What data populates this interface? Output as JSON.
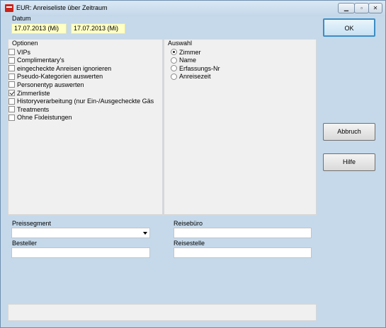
{
  "window": {
    "title": "EUR: Anreiseliste über Zeitraum",
    "controls": {
      "minimize": "▁",
      "maximize": "▫",
      "close": "✕"
    }
  },
  "datum": {
    "label": "Datum",
    "from": "17.07.2013 (Mi)",
    "to": "17.07.2013 (Mi)"
  },
  "optionen": {
    "label": "Optionen",
    "items": [
      {
        "label": "VIPs",
        "checked": false
      },
      {
        "label": "Complimentary's",
        "checked": false
      },
      {
        "label": "eingecheckte Anreisen ignorieren",
        "checked": false
      },
      {
        "label": "Pseudo-Kategorien auswerten",
        "checked": false
      },
      {
        "label": "Personentyp auswerten",
        "checked": false
      },
      {
        "label": "Zimmerliste",
        "checked": true
      },
      {
        "label": "Historyverarbeitung (nur Ein-/Ausgecheckte Gäs",
        "checked": false
      },
      {
        "label": "Treatments",
        "checked": false
      },
      {
        "label": "Ohne Fixleistungen",
        "checked": false
      }
    ]
  },
  "auswahl": {
    "label": "Auswahl",
    "items": [
      {
        "label": "Zimmer",
        "selected": true
      },
      {
        "label": "Name",
        "selected": false
      },
      {
        "label": "Erfassungs-Nr",
        "selected": false
      },
      {
        "label": "Anreisezeit",
        "selected": false
      }
    ]
  },
  "buttons": {
    "ok": "OK",
    "abbruch": "Abbruch",
    "hilfe": "Hilfe"
  },
  "filters": {
    "preissegment": {
      "label": "Preissegment",
      "value": ""
    },
    "reisebuero": {
      "label": "Reisebüro",
      "value": ""
    },
    "besteller": {
      "label": "Besteller",
      "value": ""
    },
    "reisestelle": {
      "label": "Reisestelle",
      "value": ""
    }
  }
}
